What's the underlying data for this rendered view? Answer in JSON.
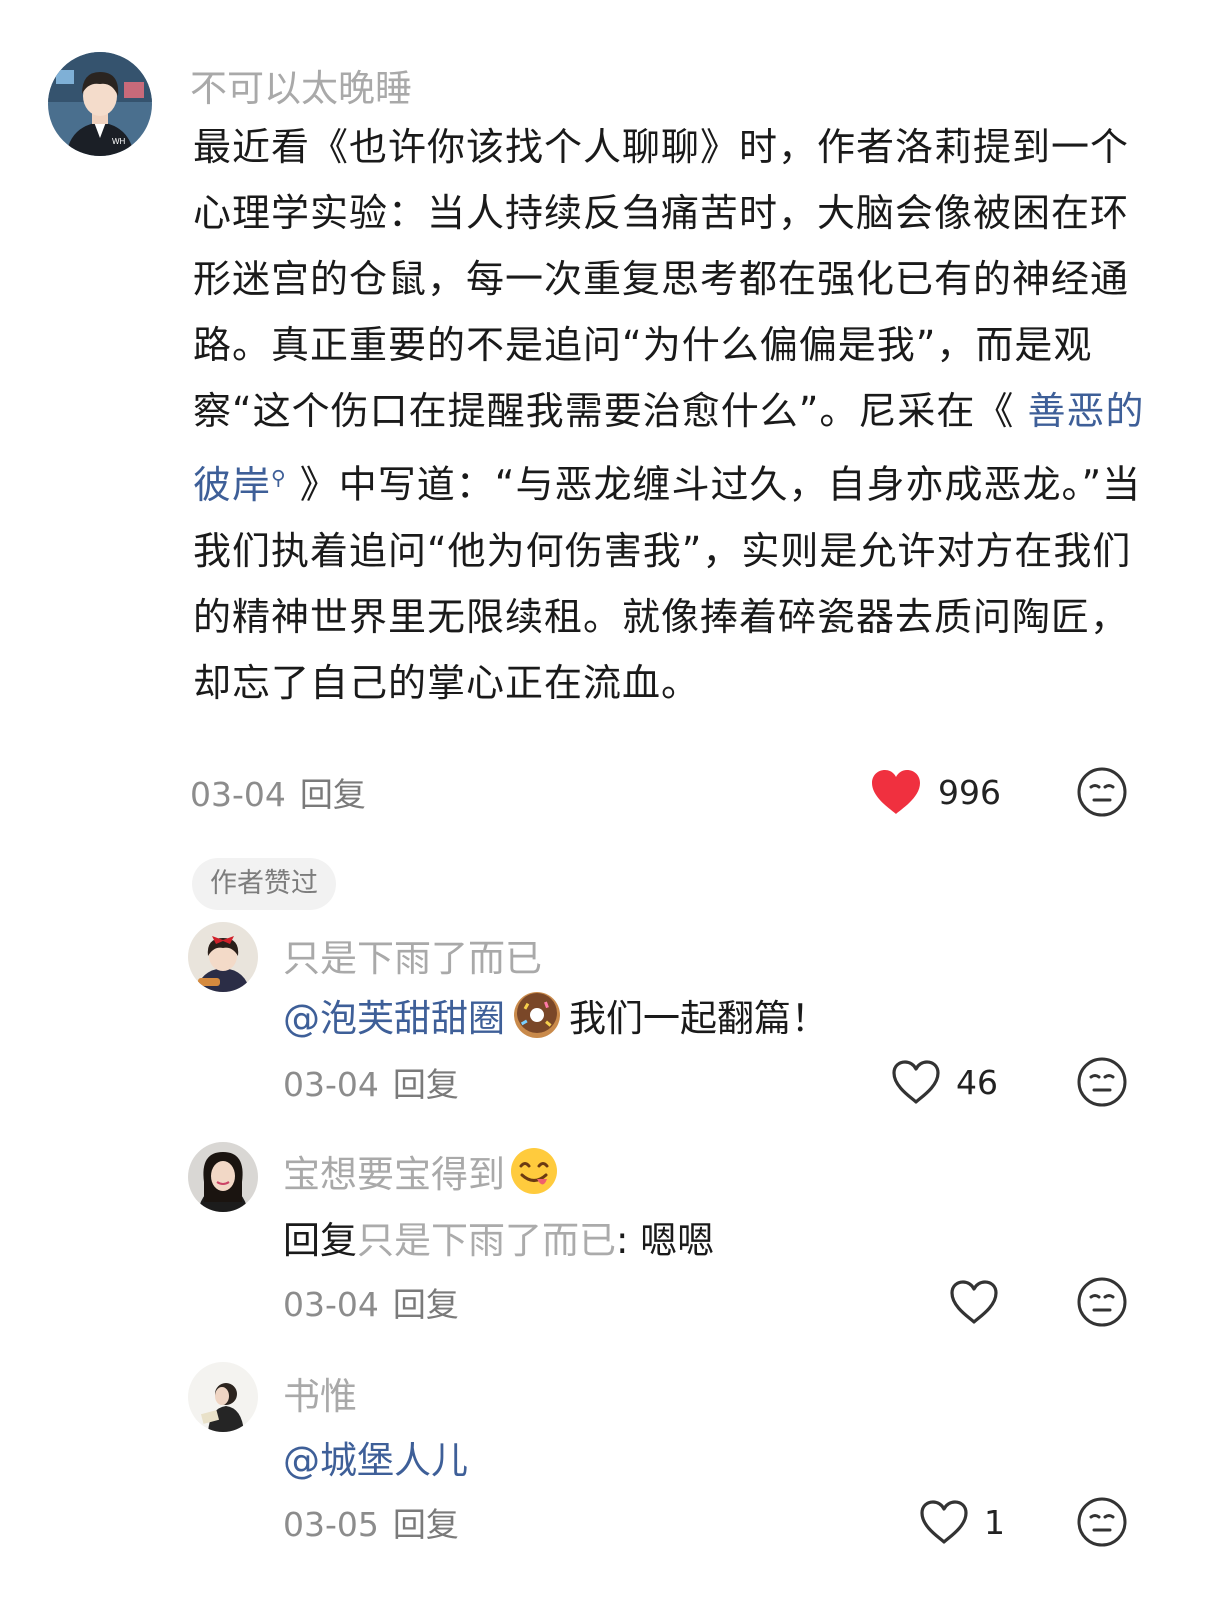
{
  "comments": [
    {
      "user": "不可以太晚睡",
      "avatar": "avatar-boy-wh",
      "body_parts": [
        "最近看《也许你该找个人聊聊》时，作者洛莉提到一个心理学实验：当人持续反刍痛苦时，大脑会像被困在环形迷宫的仓鼠，每一次重复思考都在强化已有的神经通路。真正重要的不是追问“为什么偏偏是我”，而是观察“这个伤口在提醒我需要治愈什么”。尼采在《 ",
        "善恶的彼岸",
        " 》中写道：“与恶龙缠斗过久，自身亦成恶龙。”当我们执着追问“他为何伤害我”，实则是允许对方在我们的精神世界里无限续租。就像捧着碎瓷器去质问陶匠，却忘了自己的掌心正在流血。"
      ],
      "date": "03-04",
      "reply_label": "回复",
      "likes": "996",
      "liked": true,
      "badge": "作者赞过"
    }
  ],
  "replies": [
    {
      "user": "只是下雨了而已",
      "avatar": "avatar-girl-red-bow",
      "mention": "@泡芙甜甜圈",
      "emoji": "donut-emoji",
      "text": " 我们一起翻篇！",
      "date": "03-04",
      "reply_label": "回复",
      "likes": "46",
      "liked": false
    },
    {
      "user": "宝想要宝得到",
      "user_emoji": "yum-face-emoji",
      "avatar": "avatar-girl-photo",
      "prefix": "回复",
      "reply_to": " 只是下雨了而已",
      "text": ": 嗯嗯",
      "date": "03-04",
      "reply_label": "回复",
      "likes": "",
      "liked": false
    },
    {
      "user": "书惟",
      "avatar": "avatar-reading-girl",
      "mention": "@城堡人儿",
      "date": "03-05",
      "reply_label": "回复",
      "likes": "1",
      "liked": false
    }
  ],
  "colors": {
    "like_red": "#f0303f",
    "link_blue": "#3e5f98",
    "meta_grey": "#8c8c8c"
  }
}
